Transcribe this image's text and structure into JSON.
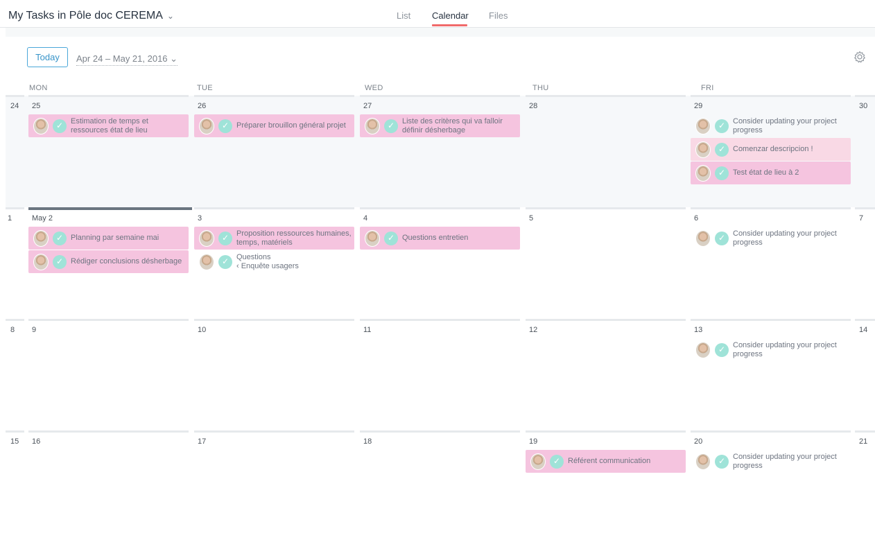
{
  "header": {
    "title": "My Tasks in Pôle doc CEREMA",
    "title_chevron": "⌄",
    "tabs": [
      {
        "label": "List",
        "active": false
      },
      {
        "label": "Calendar",
        "active": true
      },
      {
        "label": "Files",
        "active": false
      }
    ]
  },
  "toolbar": {
    "today_label": "Today",
    "date_range": "Apr 24 – May 21, 2016 ⌄",
    "settings_icon": "gear-icon"
  },
  "weekdays": [
    "MON",
    "TUE",
    "WED",
    "THU",
    "FRI"
  ],
  "weeks": [
    {
      "week_num": "24",
      "weekend_num": "30",
      "days": [
        {
          "num": "25",
          "tasks": [
            {
              "label": "Estimation de temps et ressources état de lieu",
              "style": "pink"
            }
          ]
        },
        {
          "num": "26",
          "tasks": [
            {
              "label": "Préparer brouillon général projet",
              "style": "pink"
            }
          ]
        },
        {
          "num": "27",
          "tasks": [
            {
              "label": "Liste des critères qui va falloir définir désherbage",
              "style": "pink"
            }
          ]
        },
        {
          "num": "28",
          "tasks": []
        },
        {
          "num": "29",
          "tasks": [
            {
              "label": "Consider updating your project progress",
              "style": "plain"
            },
            {
              "label": "Comenzar descripcion !",
              "style": "lightpink"
            },
            {
              "label": "Test état de lieu à 2",
              "style": "pink"
            }
          ]
        }
      ]
    },
    {
      "week_num": "1",
      "weekend_num": "7",
      "days": [
        {
          "num": "May 2",
          "tasks": [
            {
              "label": "Planning par semaine mai",
              "style": "pink"
            },
            {
              "label": "Rédiger conclusions désherbage",
              "style": "pink"
            }
          ]
        },
        {
          "num": "3",
          "tasks": [
            {
              "label": "Proposition ressources humaines, temps, matériels",
              "style": "pink"
            },
            {
              "label": "Questions",
              "sub": "‹ Enquête usagers",
              "style": "plain"
            }
          ]
        },
        {
          "num": "4",
          "tasks": [
            {
              "label": "Questions entretien",
              "style": "pink"
            }
          ]
        },
        {
          "num": "5",
          "tasks": []
        },
        {
          "num": "6",
          "tasks": [
            {
              "label": "Consider updating your project progress",
              "style": "plain"
            }
          ]
        }
      ]
    },
    {
      "week_num": "8",
      "weekend_num": "14",
      "days": [
        {
          "num": "9",
          "tasks": []
        },
        {
          "num": "10",
          "tasks": []
        },
        {
          "num": "11",
          "tasks": []
        },
        {
          "num": "12",
          "tasks": []
        },
        {
          "num": "13",
          "tasks": [
            {
              "label": "Consider updating your project progress",
              "style": "plain"
            }
          ]
        }
      ]
    },
    {
      "week_num": "15",
      "weekend_num": "21",
      "days": [
        {
          "num": "16",
          "tasks": []
        },
        {
          "num": "17",
          "tasks": []
        },
        {
          "num": "18",
          "tasks": []
        },
        {
          "num": "19",
          "tasks": [
            {
              "label": "Référent communication",
              "style": "pink"
            }
          ]
        },
        {
          "num": "20",
          "tasks": [
            {
              "label": "Consider updating your project progress",
              "style": "plain"
            }
          ]
        }
      ]
    }
  ],
  "colors": {
    "accent": "#f06a6a",
    "task_pink": "#f5c4df",
    "task_lightpink": "#f9d9e5",
    "check": "#9fe3d8",
    "today_blue": "#3794c9"
  }
}
